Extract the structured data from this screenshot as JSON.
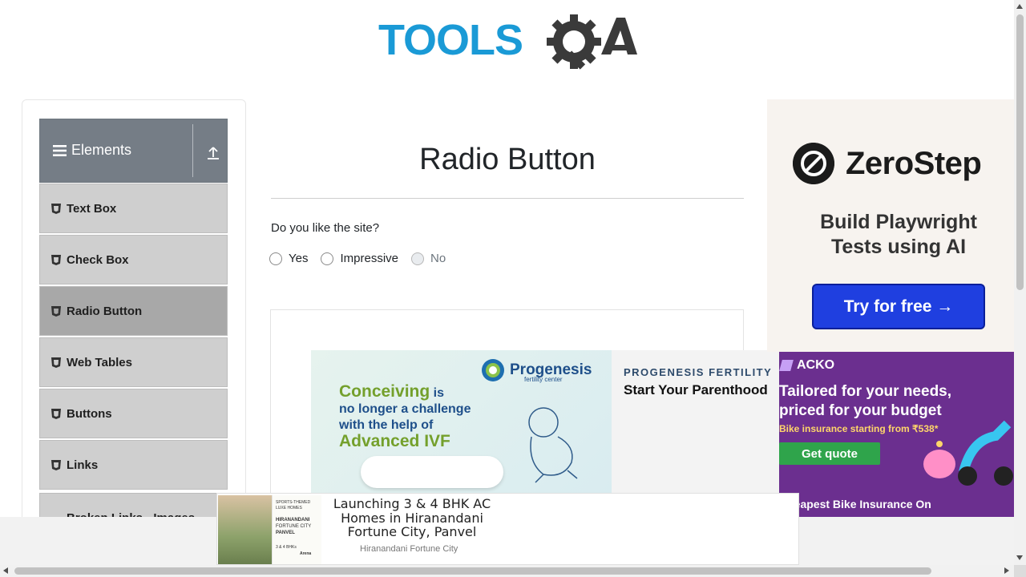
{
  "header": {
    "logo_text": "TOOLSQA"
  },
  "sidebar": {
    "group_title": "Elements",
    "items": [
      {
        "label": "Text Box"
      },
      {
        "label": "Check Box"
      },
      {
        "label": "Radio Button",
        "active": true
      },
      {
        "label": "Web Tables"
      },
      {
        "label": "Buttons"
      },
      {
        "label": "Links"
      },
      {
        "label": "Broken Links - Images"
      }
    ]
  },
  "main": {
    "title": "Radio Button",
    "question": "Do you like the site?",
    "options": [
      {
        "label": "Yes",
        "disabled": false
      },
      {
        "label": "Impressive",
        "disabled": false
      },
      {
        "label": "No",
        "disabled": true
      }
    ]
  },
  "ads": {
    "progenesis": {
      "brand": "Progenesis",
      "brand_sub": "fertility center",
      "line1_big": "Conceiving",
      "line1_rest": " is",
      "line2": "no longer a challenge",
      "line3": "with the help of",
      "line4_big": "Advanced IVF",
      "right_title": "PROGENESIS FERTILITY",
      "right_sub": "Start Your Parenthood"
    },
    "zerostep": {
      "brand": "ZeroStep",
      "headline_line1": "Build Playwright",
      "headline_line2": "Tests using AI",
      "button": "Try for free →",
      "button_color": "#1f3fe0"
    },
    "acko": {
      "brand": "ACKO",
      "headline_line1": "Tailored for your needs,",
      "headline_line2": "priced for your budget",
      "sub": "Bike insurance starting from ₹538*",
      "button": "Get quote",
      "footer": "Cheapest Bike Insurance On"
    },
    "bottom": {
      "headline": "Launching 3 & 4 BHK AC Homes in Hiranandani Fortune City, Panvel",
      "source": "Hiranandani Fortune City",
      "thumb_line1": "SPORTS-THEMED",
      "thumb_line2": "LUXE HOMES",
      "thumb_line3": "HIRANANDANI",
      "thumb_line4": "FORTUNE CITY",
      "thumb_line5": "PANVEL",
      "thumb_line6": "3 & 4 BHKs",
      "thumb_line7": "Arena"
    }
  },
  "colors": {
    "logo_blue": "#1a9ad6",
    "logo_dark": "#3a3a3a",
    "sidebar_header": "#757d86",
    "menu_bg": "#cfcfcf",
    "menu_active_bg": "#a8a8a8"
  }
}
